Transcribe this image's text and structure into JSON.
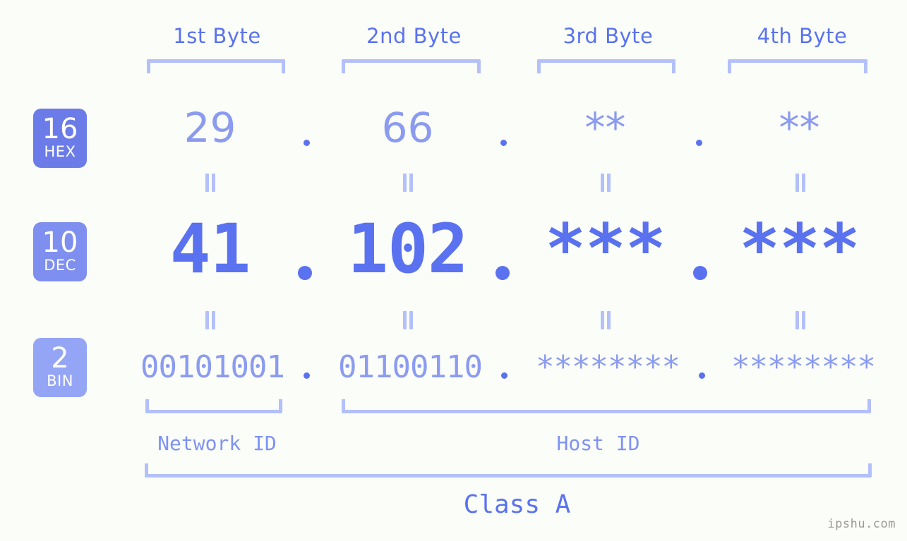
{
  "background_color": "#fbfdf8",
  "colors": {
    "strong_blue": "#5a72f0",
    "light_blue": "#8b9bf0",
    "bracket_blue": "#b4c0fa",
    "badge_hex": "#6b7ce8",
    "badge_dec": "#7f8ff0",
    "badge_bin": "#95a5f5",
    "watermark_gray": "#9a9a9a"
  },
  "byte_headers": [
    {
      "label": "1st Byte"
    },
    {
      "label": "2nd Byte"
    },
    {
      "label": "3rd Byte"
    },
    {
      "label": "4th Byte"
    }
  ],
  "rows": {
    "hex": {
      "badge_number": "16",
      "badge_name": "HEX",
      "values": [
        "29",
        "66",
        "**",
        "**"
      ],
      "separator": "."
    },
    "dec": {
      "badge_number": "10",
      "badge_name": "DEC",
      "values": [
        "41",
        "102",
        "***",
        "***"
      ],
      "separator": "."
    },
    "bin": {
      "badge_number": "2",
      "badge_name": "BIN",
      "values": [
        "00101001",
        "01100110",
        "********",
        "********"
      ],
      "separator": "."
    }
  },
  "equivalence_symbol": "=",
  "footer": {
    "network_id_label": "Network ID",
    "host_id_label": "Host ID",
    "class_label": "Class A"
  },
  "watermark": "ipshu.com"
}
